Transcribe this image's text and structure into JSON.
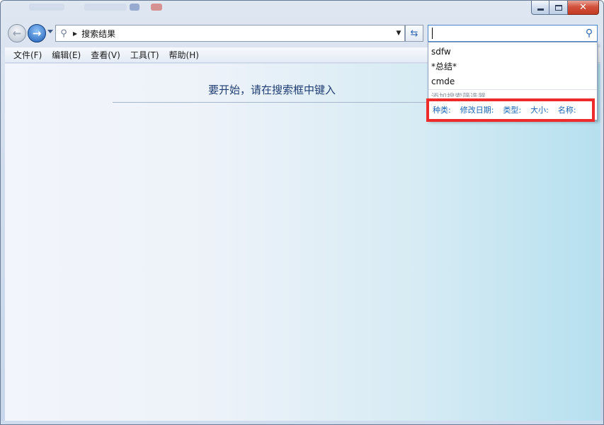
{
  "window": {
    "accent": "#3167b5",
    "close_glyph": "✕"
  },
  "navigation": {
    "back_glyph": "←",
    "forward_glyph": "→",
    "address": "搜索结果",
    "address_icon": "search-icon"
  },
  "search": {
    "value": "",
    "recent": [
      "sdfw",
      "*总结*",
      "cmde"
    ],
    "add_filter_label": "添加搜索筛选器",
    "filters": [
      "种类:",
      "修改日期:",
      "类型:",
      "大小:",
      "名称:"
    ],
    "filter_color": "#1a65b4"
  },
  "menu": [
    "文件(F)",
    "编辑(E)",
    "查看(V)",
    "工具(T)",
    "帮助(H)"
  ],
  "content": {
    "hint": "要开始，请在搜索框中键入"
  },
  "annotation": {
    "highlight_color": "#ee2b2b"
  }
}
